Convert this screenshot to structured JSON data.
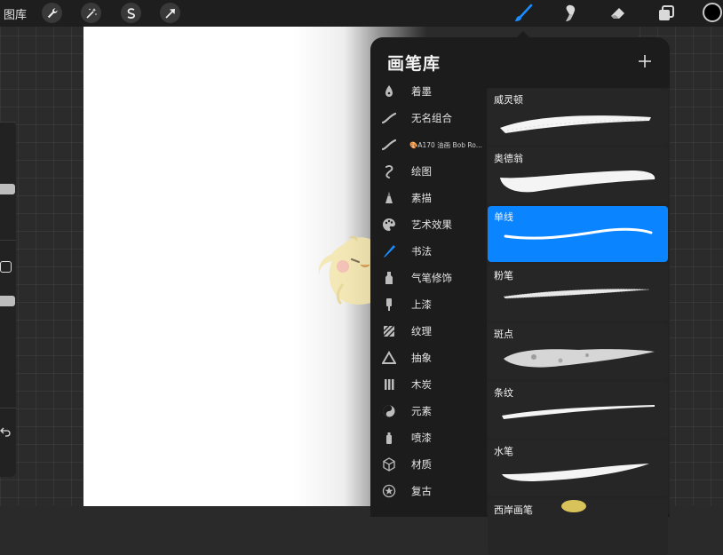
{
  "topbar": {
    "gallery_label": "图库",
    "action_icons": [
      "wrench-icon",
      "magic-wand-icon",
      "selection-icon",
      "transform-arrow-icon"
    ],
    "tool_icons": [
      "brush-icon",
      "smudge-icon",
      "eraser-icon",
      "layers-icon"
    ],
    "active_tool": "brush",
    "current_color": "#000000",
    "accent": "#0a84ff"
  },
  "brush_library": {
    "title": "画笔库",
    "add_icon": "plus-icon",
    "sets": [
      {
        "label": "着墨",
        "icon": "ink-drop-icon",
        "small": false
      },
      {
        "label": "无名组合",
        "icon": "stroke-icon",
        "small": false
      },
      {
        "label": "🎨A170 油画 Bob Ro...",
        "icon": "stroke-icon",
        "small": true
      },
      {
        "label": "绘图",
        "icon": "curl-icon",
        "small": false
      },
      {
        "label": "素描",
        "icon": "pencil-tip-icon",
        "small": false
      },
      {
        "label": "艺术效果",
        "icon": "palette-icon",
        "small": false
      },
      {
        "label": "书法",
        "icon": "calligraphy-pen-icon",
        "small": false,
        "active": true
      },
      {
        "label": "气笔修饰",
        "icon": "airbrush-icon",
        "small": false
      },
      {
        "label": "上漆",
        "icon": "paint-tube-icon",
        "small": false
      },
      {
        "label": "纹理",
        "icon": "hatch-texture-icon",
        "small": false
      },
      {
        "label": "抽象",
        "icon": "triangle-icon",
        "small": false
      },
      {
        "label": "木炭",
        "icon": "charcoal-bars-icon",
        "small": false
      },
      {
        "label": "元素",
        "icon": "yin-yang-icon",
        "small": false
      },
      {
        "label": "喷漆",
        "icon": "spray-can-icon",
        "small": false
      },
      {
        "label": "材质",
        "icon": "cube-icon",
        "small": false
      },
      {
        "label": "复古",
        "icon": "star-badge-icon",
        "small": false
      }
    ],
    "brushes": [
      {
        "name": "威灵顿",
        "selected": false
      },
      {
        "name": "奥德翁",
        "selected": false
      },
      {
        "name": "单线",
        "selected": true
      },
      {
        "name": "粉笔",
        "selected": false
      },
      {
        "name": "斑点",
        "selected": false
      },
      {
        "name": "条纹",
        "selected": false
      },
      {
        "name": "水笔",
        "selected": false
      },
      {
        "name": "西岸画笔",
        "selected": false
      }
    ]
  }
}
